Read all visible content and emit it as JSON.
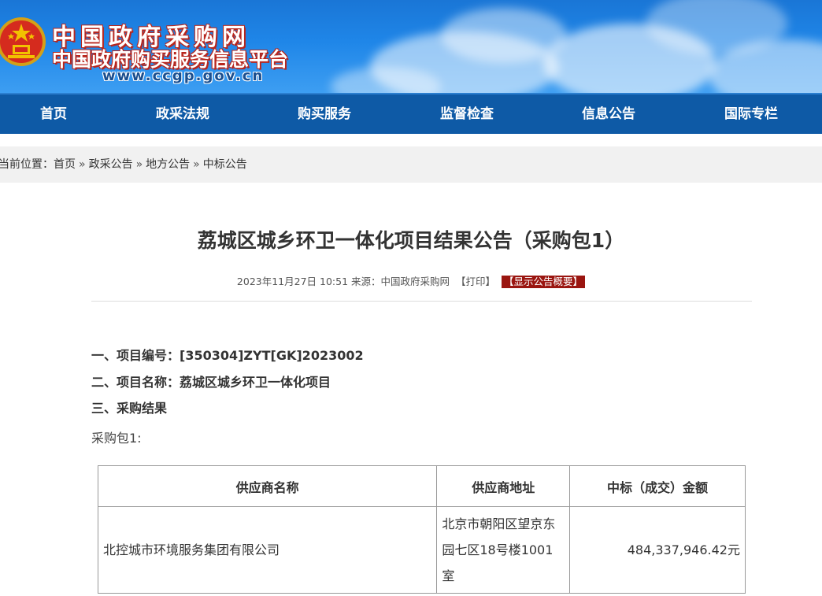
{
  "header": {
    "site_name": "中国政府采购网",
    "site_subname": "中国政府购买服务信息平台",
    "site_url": "www.ccgp.gov.cn",
    "emblem_icon": "national-emblem-icon"
  },
  "nav": {
    "items": [
      {
        "label": "首页"
      },
      {
        "label": "政采法规"
      },
      {
        "label": "购买服务"
      },
      {
        "label": "监督检查"
      },
      {
        "label": "信息公告"
      },
      {
        "label": "国际专栏"
      }
    ]
  },
  "breadcrumb": {
    "prefix": "当前位置：",
    "items": [
      "首页",
      "政采公告",
      "地方公告",
      "中标公告"
    ],
    "separator": "»"
  },
  "article": {
    "title": "荔城区城乡环卫一体化项目结果公告（采购包1）",
    "date": "2023年11月27日 10:51",
    "source_label": "来源：",
    "source": "中国政府采购网",
    "print_label": "【打印】",
    "summary_label": "【显示公告概要】",
    "sections": [
      {
        "text": "一、项目编号：[350304]ZYT[GK]2023002"
      },
      {
        "text": "二、项目名称：荔城区城乡环卫一体化项目"
      },
      {
        "text": "三、采购结果"
      }
    ],
    "package_label": "采购包1:",
    "table": {
      "headers": [
        "供应商名称",
        "供应商地址",
        "中标（成交）金额"
      ],
      "rows": [
        {
          "name": "北控城市环境服务集团有限公司",
          "address": "北京市朝阳区望京东园七区18号楼1001室",
          "amount": "484,337,946.42元"
        }
      ]
    }
  },
  "colors": {
    "nav_bg": "#0e5aa6",
    "banner_bg": "#1f86e8",
    "summary_btn_bg": "#9a1510",
    "breadcrumb_bg": "#f1f1f1"
  }
}
